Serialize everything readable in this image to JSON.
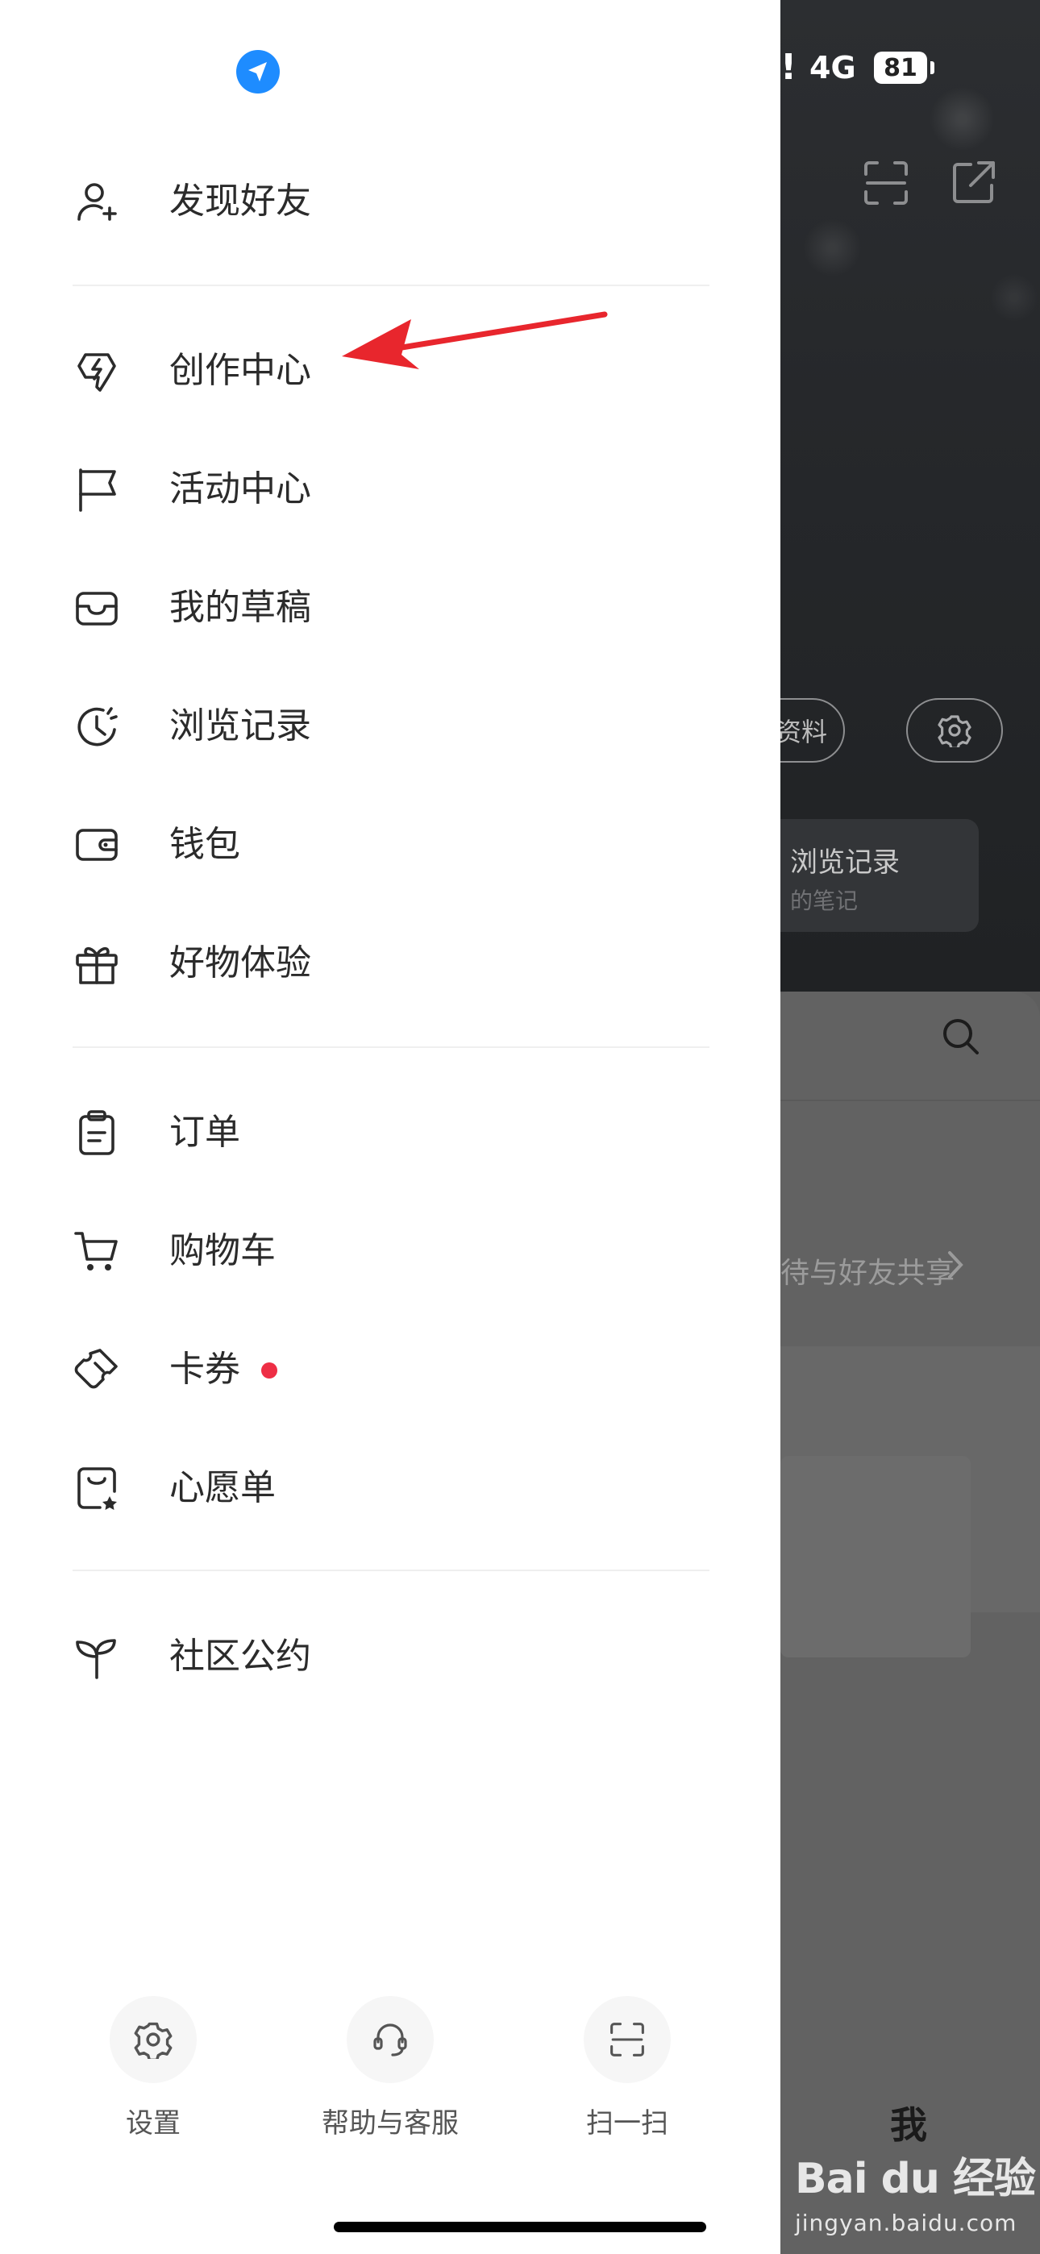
{
  "status_bar": {
    "signal_alert": "!",
    "network": "4G",
    "battery": "81"
  },
  "background": {
    "edit_profile_partial": "资料",
    "history_card": {
      "title": "浏览记录",
      "subtitle": "的笔记"
    },
    "share_prompt": "待与好友共享",
    "tab_me": "我"
  },
  "drawer": {
    "groups": [
      [
        {
          "label": "发现好友",
          "icon": "add-friend-icon"
        }
      ],
      [
        {
          "label": "创作中心",
          "icon": "lightning-icon"
        },
        {
          "label": "活动中心",
          "icon": "flag-icon"
        },
        {
          "label": "我的草稿",
          "icon": "inbox-icon"
        },
        {
          "label": "浏览记录",
          "icon": "history-clock-icon"
        },
        {
          "label": "钱包",
          "icon": "wallet-icon"
        },
        {
          "label": "好物体验",
          "icon": "gift-icon"
        }
      ],
      [
        {
          "label": "订单",
          "icon": "clipboard-icon"
        },
        {
          "label": "购物车",
          "icon": "cart-icon"
        },
        {
          "label": "卡券",
          "icon": "coupon-icon",
          "badge_dot": true
        },
        {
          "label": "心愿单",
          "icon": "wishlist-bag-icon"
        }
      ],
      [
        {
          "label": "社区公约",
          "icon": "sprout-icon"
        }
      ]
    ],
    "bottom_actions": [
      {
        "label": "设置",
        "icon": "gear-icon"
      },
      {
        "label": "帮助与客服",
        "icon": "headset-icon"
      },
      {
        "label": "扫一扫",
        "icon": "scan-icon"
      }
    ]
  },
  "watermark": {
    "brand": "Bai du 经验",
    "site": "jingyan.baidu.com"
  },
  "colors": {
    "accent_blue": "#1e8cff",
    "badge_red": "#ee2e45",
    "annotation_arrow": "#e8262d"
  }
}
